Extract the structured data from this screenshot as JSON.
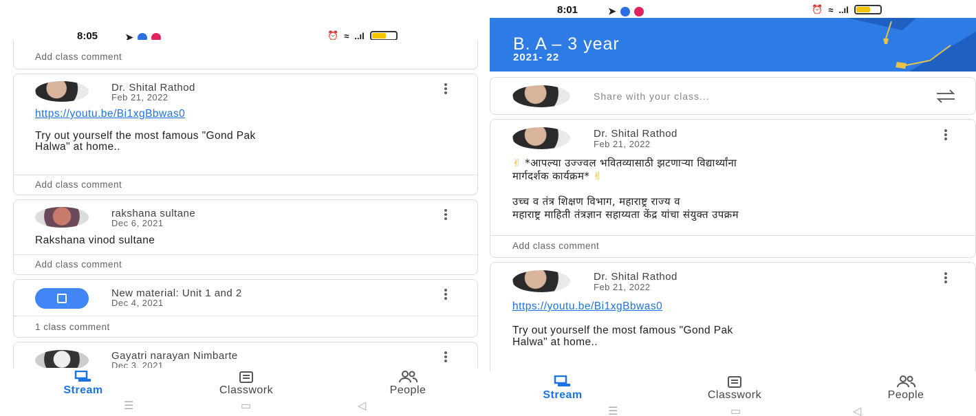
{
  "left": {
    "time": "8:05",
    "posts": [
      {
        "comment": "Add class comment"
      },
      {
        "name": "Dr. Shital Rathod",
        "date": "Feb 21, 2022",
        "link": "https://youtu.be/Bi1xgBbwas0",
        "text1": "Try out yourself  the most famous \"Gond Pak",
        "text2": "Halwa\" at home..",
        "comment": "Add class comment"
      },
      {
        "name": "rakshana sultane",
        "date": "Dec 6, 2021",
        "text1": "Rakshana vinod sultane",
        "comment": "Add class comment"
      },
      {
        "name": "New material: Unit 1 and 2",
        "date": "Dec 4, 2021",
        "comment": "1 class comment"
      },
      {
        "name": "Gayatri narayan Nimbarte",
        "date": "Dec 3, 2021"
      }
    ],
    "nav": {
      "stream": "Stream",
      "classwork": "Classwork",
      "people": "People"
    }
  },
  "right": {
    "time": "8:01",
    "class_title": "B. A – 3 year",
    "class_year": "2021- 22",
    "share_placeholder": "Share with your class...",
    "posts": [
      {
        "name": "Dr. Shital Rathod",
        "date": "Feb 21, 2022",
        "line1": "*आपल्या उज्ज्वल भवितव्यासाठी झटणाऱ्या विद्यार्थ्यांना",
        "line2": "मार्गदर्शक कार्यक्रम*",
        "line3": "उच्च व तंत्र शिक्षण विभाग, महाराष्ट्र राज्य व",
        "line4": "महाराष्ट्र माहिती तंत्रज्ञान सहाय्यता केंद्र यांचा संयुक्त उपक्रम",
        "comment": "Add class comment"
      },
      {
        "name": "Dr. Shital Rathod",
        "date": "Feb 21, 2022",
        "link": "https://youtu.be/Bi1xgBbwas0",
        "text1": "Try out yourself  the most famous \"Gond Pak",
        "text2": "Halwa\" at home.."
      }
    ],
    "nav": {
      "stream": "Stream",
      "classwork": "Classwork",
      "people": "People"
    }
  },
  "colors": {
    "accent": "#1a73e8",
    "banner": "#2d7be5"
  }
}
